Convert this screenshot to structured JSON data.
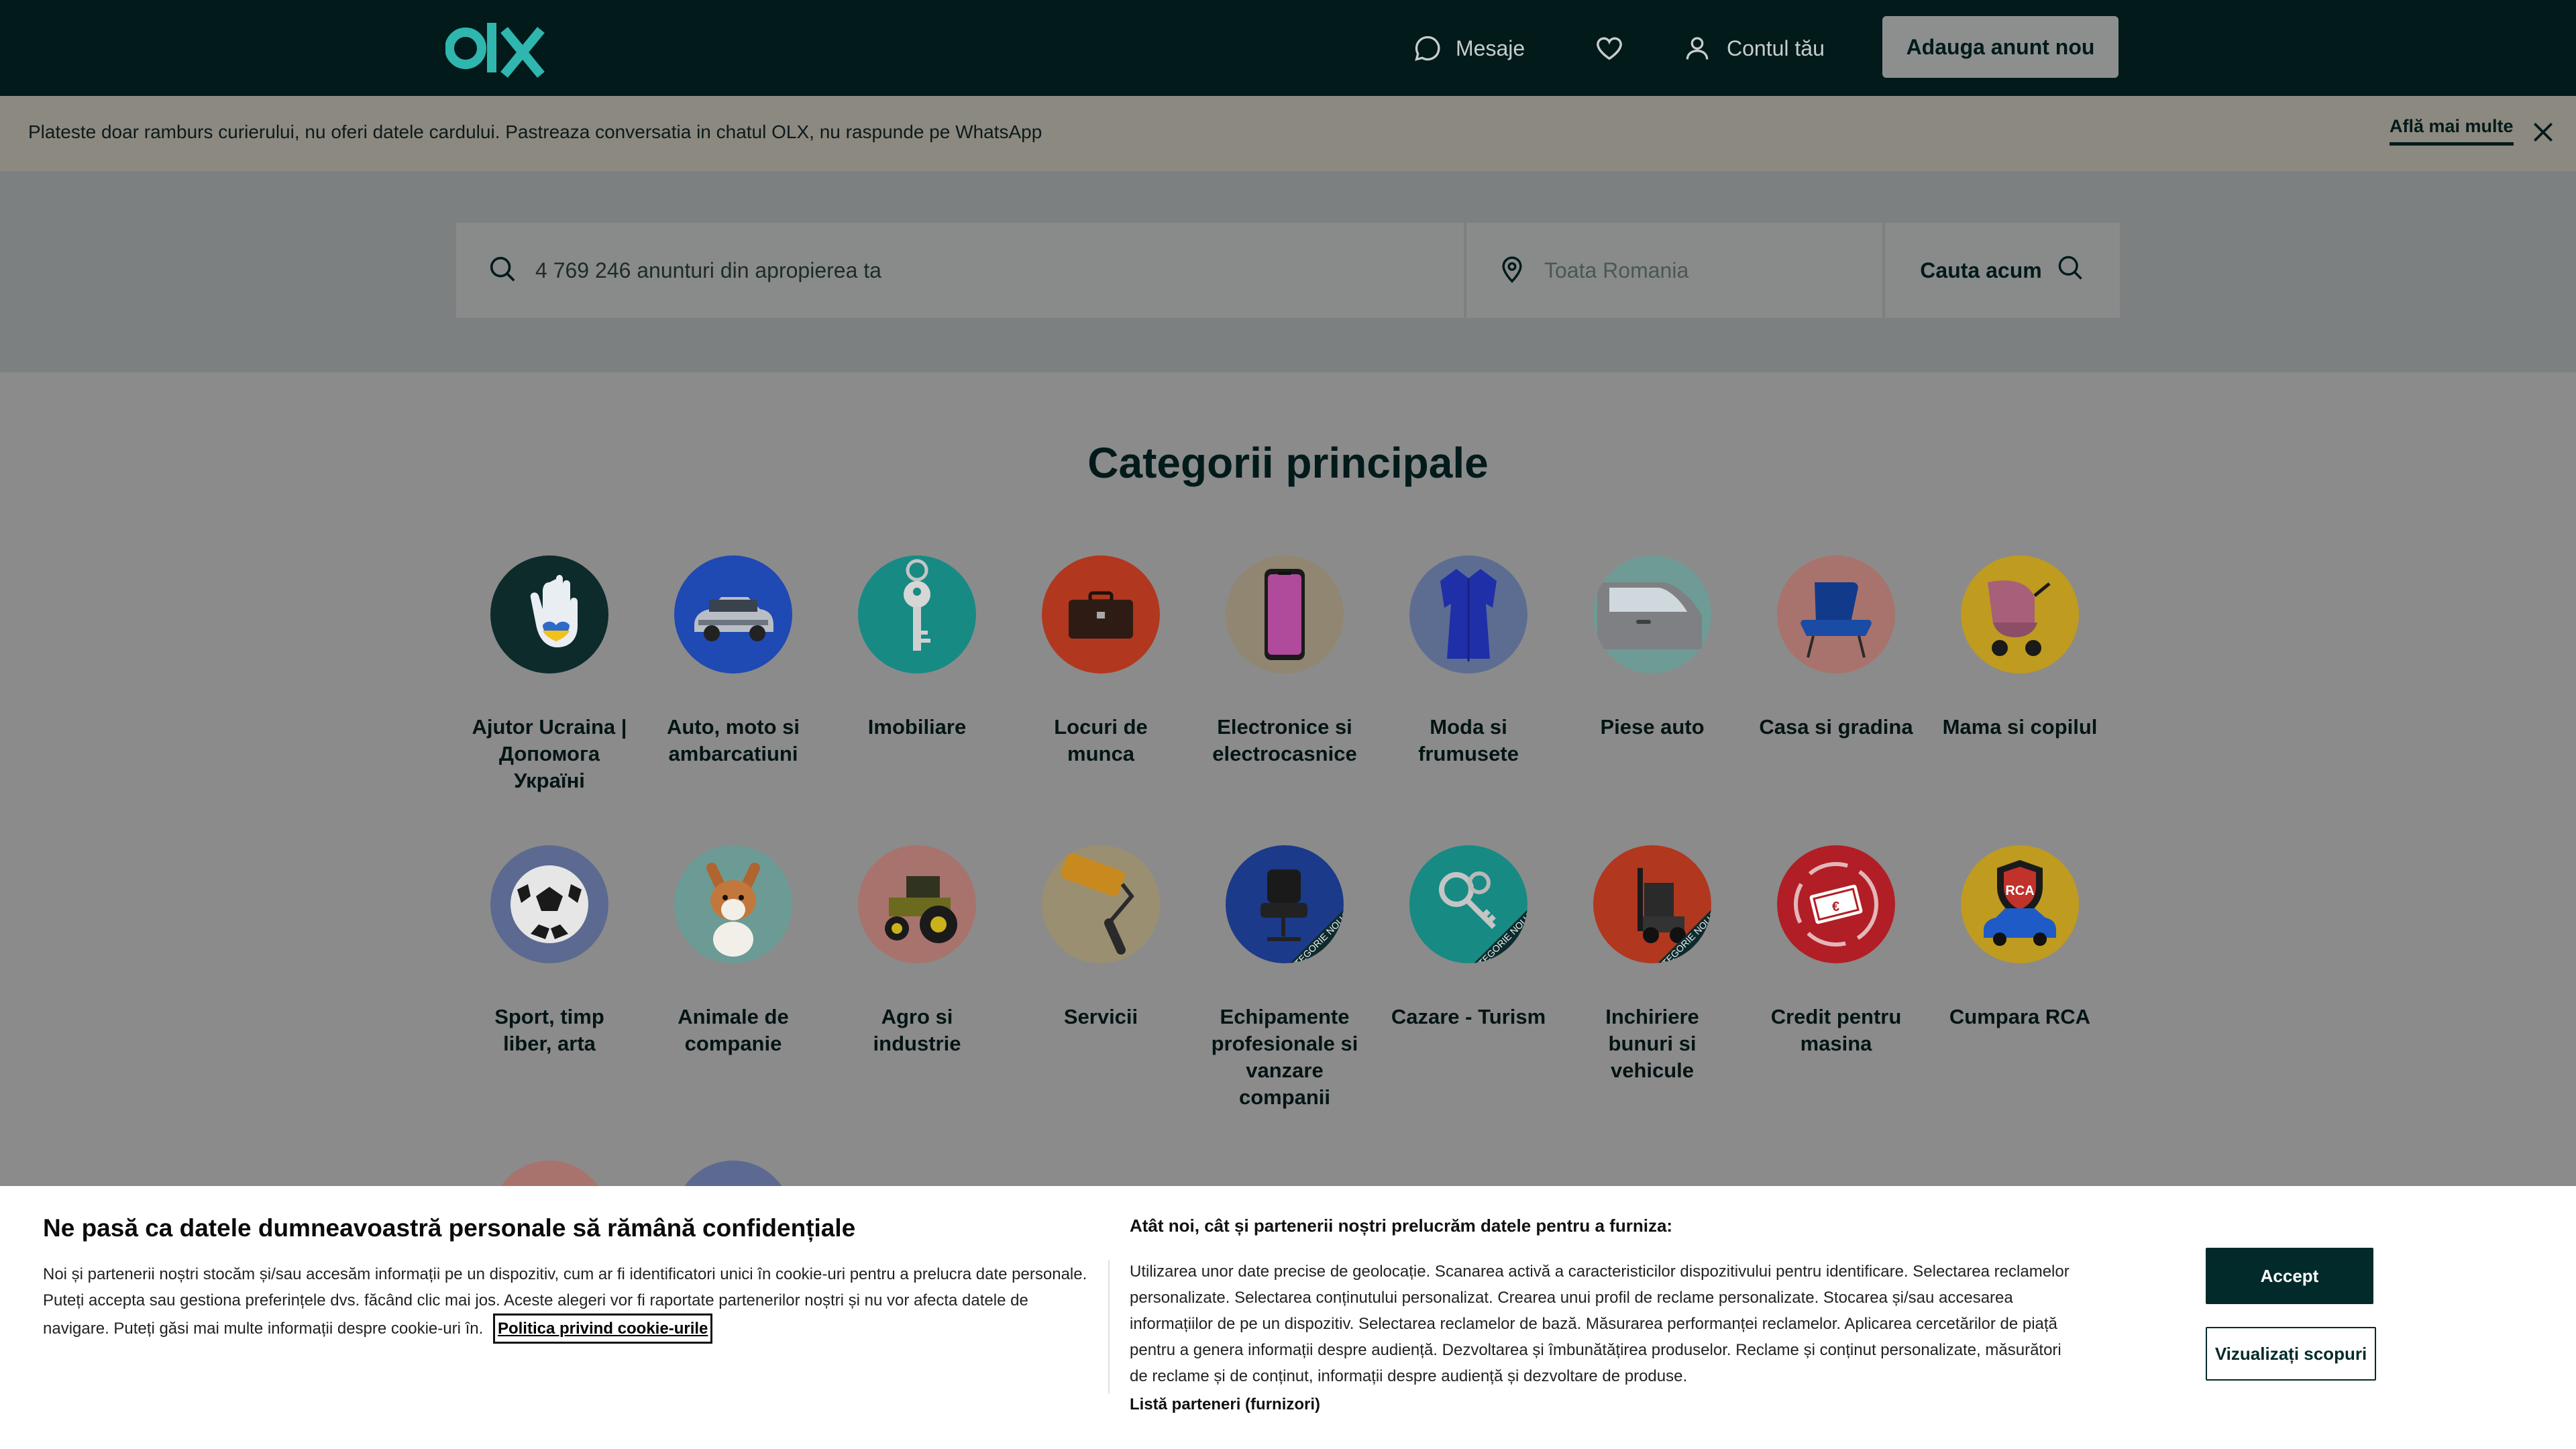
{
  "header": {
    "logo_text": "olx",
    "messages_label": "Mesaje",
    "account_label": "Contul tău",
    "post_button_label": "Adauga anunt nou"
  },
  "alert": {
    "text": "Plateste doar ramburs curierului, nu oferi datele cardului. Pastreaza conversatia in chatul OLX, nu raspunde pe WhatsApp",
    "more_label": "Află mai multe"
  },
  "search": {
    "query_placeholder": "4 769 246 anunturi din apropierea ta",
    "location_placeholder": "Toata Romania",
    "button_label": "Cauta acum"
  },
  "categories": {
    "title": "Categorii principale",
    "items": [
      {
        "label": "Ajutor Ucraina | Допомога Україні",
        "icon": "ukraine-help-icon",
        "color": "#0d2b2b"
      },
      {
        "label": "Auto, moto si ambarcatiuni",
        "icon": "car-icon",
        "color": "#1f49b3"
      },
      {
        "label": "Imobiliare",
        "icon": "key-icon",
        "color": "#178a84"
      },
      {
        "label": "Locuri de munca",
        "icon": "briefcase-icon",
        "color": "#b2371f"
      },
      {
        "label": "Electronice si electrocasnice",
        "icon": "phone-icon",
        "color": "#908672"
      },
      {
        "label": "Moda si frumusete",
        "icon": "dress-icon",
        "color": "#5d6d92"
      },
      {
        "label": "Piese auto",
        "icon": "car-door-icon",
        "color": "#6e9b95"
      },
      {
        "label": "Casa si gradina",
        "icon": "armchair-icon",
        "color": "#a8736d"
      },
      {
        "label": "Mama si copilul",
        "icon": "stroller-icon",
        "color": "#bf9b1f"
      },
      {
        "label": "Sport, timp liber, arta",
        "icon": "football-icon",
        "color": "#5c6a91"
      },
      {
        "label": "Animale de companie",
        "icon": "dog-icon",
        "color": "#6c9b95"
      },
      {
        "label": "Agro si industrie",
        "icon": "tractor-icon",
        "color": "#a8736d"
      },
      {
        "label": "Servicii",
        "icon": "paint-roller-icon",
        "color": "#9b8f72"
      },
      {
        "label": "Echipamente profesionale si vanzare companii",
        "icon": "chair-icon",
        "color": "#1b3a8a"
      },
      {
        "label": "Cazare - Turism",
        "icon": "keys-icon",
        "color": "#178a84"
      },
      {
        "label": "Inchiriere bunuri si vehicule",
        "icon": "forklift-icon",
        "color": "#b2371f"
      },
      {
        "label": "Credit pentru masina",
        "icon": "money-icon",
        "color": "#b21e25"
      },
      {
        "label": "Cumpara RCA",
        "icon": "rca-shield-icon",
        "color": "#bf9b1f"
      }
    ],
    "badge_new": "CATEGORIE NOUA",
    "rca_text": "RCA"
  },
  "cookie": {
    "title": "Ne pasă ca datele dumneavoastră personale să rămână confidențiale",
    "body": "Noi și partenerii noștri stocăm și/sau accesăm informații pe un dispozitiv, cum ar fi identificatori unici în cookie-uri pentru a prelucra date personale. Puteți accepta sau gestiona preferințele dvs. făcând clic mai jos. Aceste alegeri vor fi raportate partenerilor noștri și nu vor afecta datele de navigare. Puteți găsi mai multe informații despre cookie-uri în.",
    "policy_link": "Politica privind cookie-urile",
    "title2": "Atât noi, cât și partenerii noștri prelucrăm datele pentru a furniza:",
    "body2": "Utilizarea unor date precise de geolocație. Scanarea activă a caracteristicilor dispozitivului pentru identificare. Selectarea reclamelor personalizate. Selectarea conținutului personalizat. Crearea unui profil de reclame personalizate. Stocarea și/sau accesarea informațiilor de pe un dispozitiv. Selectarea reclamelor de bază. Măsurarea performanței reclamelor. Aplicarea cercetărilor de piață pentru a genera informații despre audiență. Dezvoltarea și îmbunătățirea produselor. Reclame și conținut personalizate, măsurători de reclame și de conținut, informații despre audiență și dezvoltare de produse.",
    "partners_link": "Listă parteneri (furnizori)",
    "accept_label": "Accept",
    "view_label": "Vizualizați scopuri"
  }
}
